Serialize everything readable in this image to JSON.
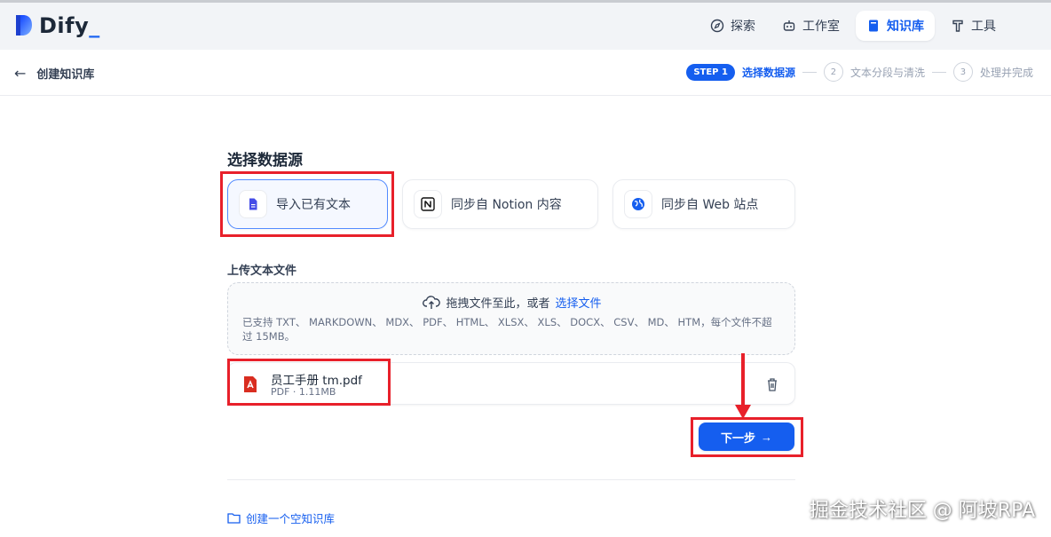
{
  "brand": {
    "name": "Dify",
    "cursor": "_",
    "accent": "#155eef"
  },
  "nav": {
    "items": [
      {
        "label": "探索",
        "icon": "compass-icon",
        "active": false
      },
      {
        "label": "工作室",
        "icon": "robot-icon",
        "active": false
      },
      {
        "label": "知识库",
        "icon": "book-icon",
        "active": true
      },
      {
        "label": "工具",
        "icon": "hammer-icon",
        "active": false
      }
    ]
  },
  "subheader": {
    "back_title": "创建知识库",
    "steps": {
      "badge": "STEP 1",
      "step1": "选择数据源",
      "step2_num": "2",
      "step2": "文本分段与清洗",
      "step3_num": "3",
      "step3": "处理并完成"
    }
  },
  "main": {
    "section_title": "选择数据源",
    "sources": [
      {
        "label": "导入已有文本",
        "icon": "file-text-icon",
        "active": true
      },
      {
        "label": "同步自 Notion 内容",
        "icon": "notion-icon",
        "active": false
      },
      {
        "label": "同步自 Web 站点",
        "icon": "globe-icon",
        "active": false
      }
    ],
    "upload_label": "上传文本文件",
    "dropzone": {
      "prompt": "拖拽文件至此，或者",
      "link": "选择文件",
      "note": "已支持 TXT、 MARKDOWN、 MDX、 PDF、 HTML、 XLSX、 XLS、 DOCX、 CSV、 MD、 HTM，每个文件不超过 15MB。"
    },
    "file": {
      "name": "员工手册 tm.pdf",
      "meta": "PDF · 1.11MB",
      "icon": "pdf-icon"
    },
    "next_label": "下一步",
    "empty_link": "创建一个空知识库"
  },
  "watermark": "掘金技术社区 @ 阿坡RPA"
}
